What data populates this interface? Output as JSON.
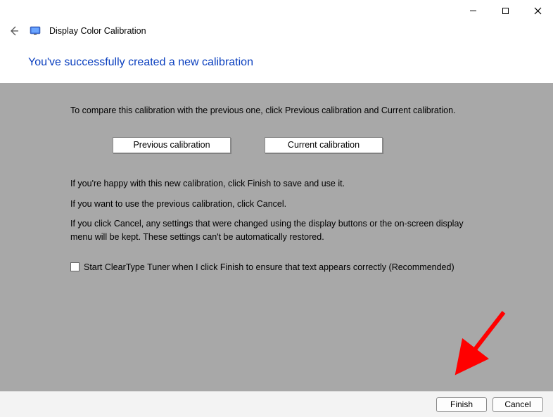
{
  "titlebar": {
    "minimize": "—",
    "maximize": "▭",
    "close": "✕"
  },
  "header": {
    "app_title": "Display Color Calibration"
  },
  "heading": "You've successfully created a new calibration",
  "content": {
    "p1": "To compare this calibration with the previous one, click Previous calibration and Current calibration.",
    "btn_prev": "Previous calibration",
    "btn_curr": "Current calibration",
    "p2": "If you're happy with this new calibration, click Finish to save and use it.",
    "p3": "If you want to use the previous calibration, click Cancel.",
    "p4": "If you click Cancel, any settings that were changed using the display buttons or the on-screen display menu will be kept. These settings can't be automatically restored.",
    "checkbox_label": "Start ClearType Tuner when I click Finish to ensure that text appears correctly (Recommended)"
  },
  "footer": {
    "finish": "Finish",
    "cancel": "Cancel"
  }
}
